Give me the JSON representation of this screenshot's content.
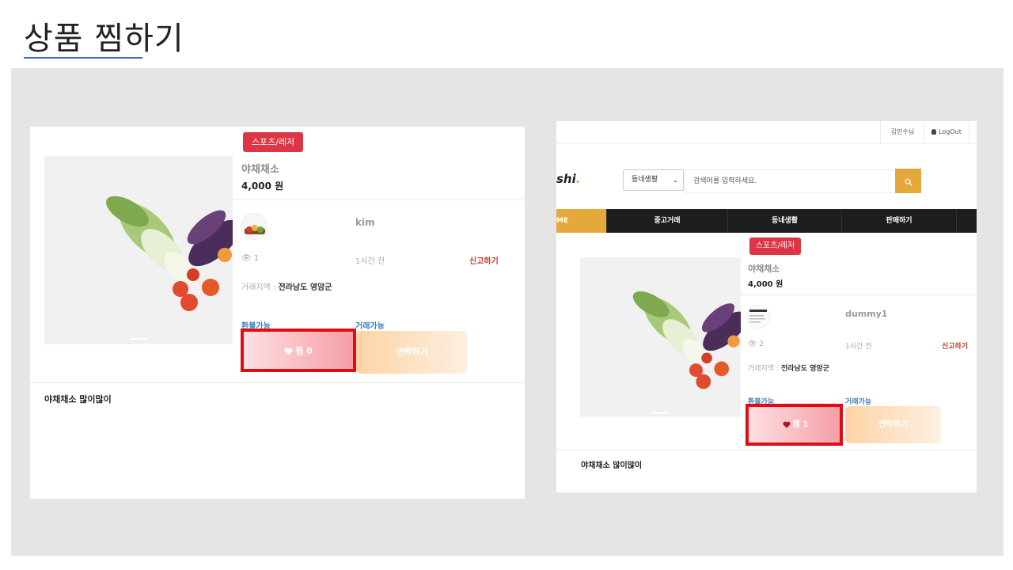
{
  "slide": {
    "title": "상품 찜하기"
  },
  "colors": {
    "accent": "#3f6aa8",
    "badge": "#dc3545",
    "highlight": "#e00b13",
    "nav_active": "#e5a93b",
    "report": "#c0392b",
    "status": "#3f7fc0"
  },
  "left": {
    "category": "스포츠/레저",
    "product_title": "야채채소",
    "price": "4,000 원",
    "seller": "kim",
    "views": "1",
    "time_ago": "1시간 전",
    "report": "신고하기",
    "area_label": "거래지역 : ",
    "area_value": "전라남도 영암군",
    "status_refund": "환불가능",
    "status_trade": "거래가능",
    "like_label": "찜 0",
    "contact_label": "연락하기",
    "description": "야채채소 많이많이"
  },
  "right": {
    "user_name": "김민수님",
    "logout": "LogOut",
    "logo_text": "shi",
    "logo_dot": ".",
    "search_select": "동네생활",
    "search_placeholder": "검색어를 입력하세요.",
    "nav": {
      "home": "ME",
      "used_trade": "중고거래",
      "neighborhood": "동네생활",
      "sell": "판매하기"
    },
    "category": "스포츠/레저",
    "product_title": "야채채소",
    "price": "4,000 원",
    "seller": "dummy1",
    "views": "2",
    "time_ago": "1시간 전",
    "report": "신고하기",
    "area_label": "거래지역 : ",
    "area_value": "전라남도 영암군",
    "status_refund": "환불가능",
    "status_trade": "거래가능",
    "like_label": "찜 1",
    "contact_label": "연락하기",
    "description": "야채채소 많이많이"
  }
}
